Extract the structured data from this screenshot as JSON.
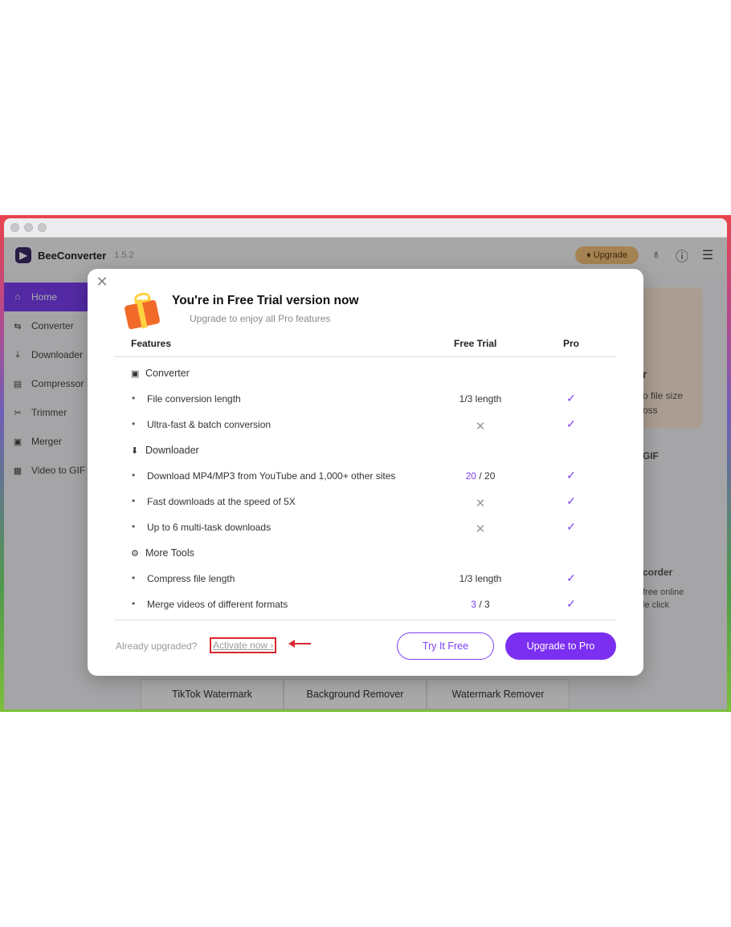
{
  "app": {
    "name": "BeeConverter",
    "version": "1.5.2",
    "upgrade_label": "Upgrade"
  },
  "sidebar": {
    "items": [
      {
        "label": "Home",
        "icon": "home-icon"
      },
      {
        "label": "Converter",
        "icon": "convert-icon"
      },
      {
        "label": "Downloader",
        "icon": "download-icon"
      },
      {
        "label": "Compressor",
        "icon": "compress-icon"
      },
      {
        "label": "Trimmer",
        "icon": "scissors-icon"
      },
      {
        "label": "Merger",
        "icon": "merge-icon"
      },
      {
        "label": "Video to GIF",
        "icon": "gif-icon"
      }
    ]
  },
  "background": {
    "fragments": [
      "r",
      "o file size",
      "oss",
      "GIF",
      "corder",
      "free online",
      "le click"
    ],
    "bottom_tabs": [
      "TikTok Watermark",
      "Background Remover",
      "Watermark Remover"
    ]
  },
  "modal": {
    "title": "You're in Free Trial version now",
    "subtitle": "Upgrade to enjoy all Pro features",
    "columns": {
      "features": "Features",
      "free": "Free Trial",
      "pro": "Pro"
    },
    "sections": {
      "converter": "Converter",
      "downloader": "Downloader",
      "more_tools": "More Tools"
    },
    "rows": {
      "r1": {
        "text": "File conversion length",
        "free": "1/3 length"
      },
      "r2": {
        "text": "Ultra-fast & batch conversion",
        "free": "✕"
      },
      "r3": {
        "text": "Download MP4/MP3 from YouTube and 1,000+ other sites",
        "free_used": "20",
        "free_sep": "/",
        "free_total": "20"
      },
      "r4": {
        "text": "Fast downloads at the speed of 5X",
        "free": "✕"
      },
      "r5": {
        "text": "Up to 6 multi-task downloads",
        "free": "✕"
      },
      "r6": {
        "text": "Compress file length",
        "free": "1/3 length"
      },
      "r7": {
        "text": "Merge videos of different formats",
        "free_used": "3",
        "free_sep": "/",
        "free_total": "3"
      }
    },
    "pro_check": "✓",
    "bullet": "•",
    "already_label": "Already upgraded?",
    "activate_label": "Activate now ›",
    "try_label": "Try It Free",
    "upgrade_label": "Upgrade to Pro"
  },
  "colors": {
    "accent": "#7b3ff2",
    "highlight_border": "#d9272e"
  }
}
